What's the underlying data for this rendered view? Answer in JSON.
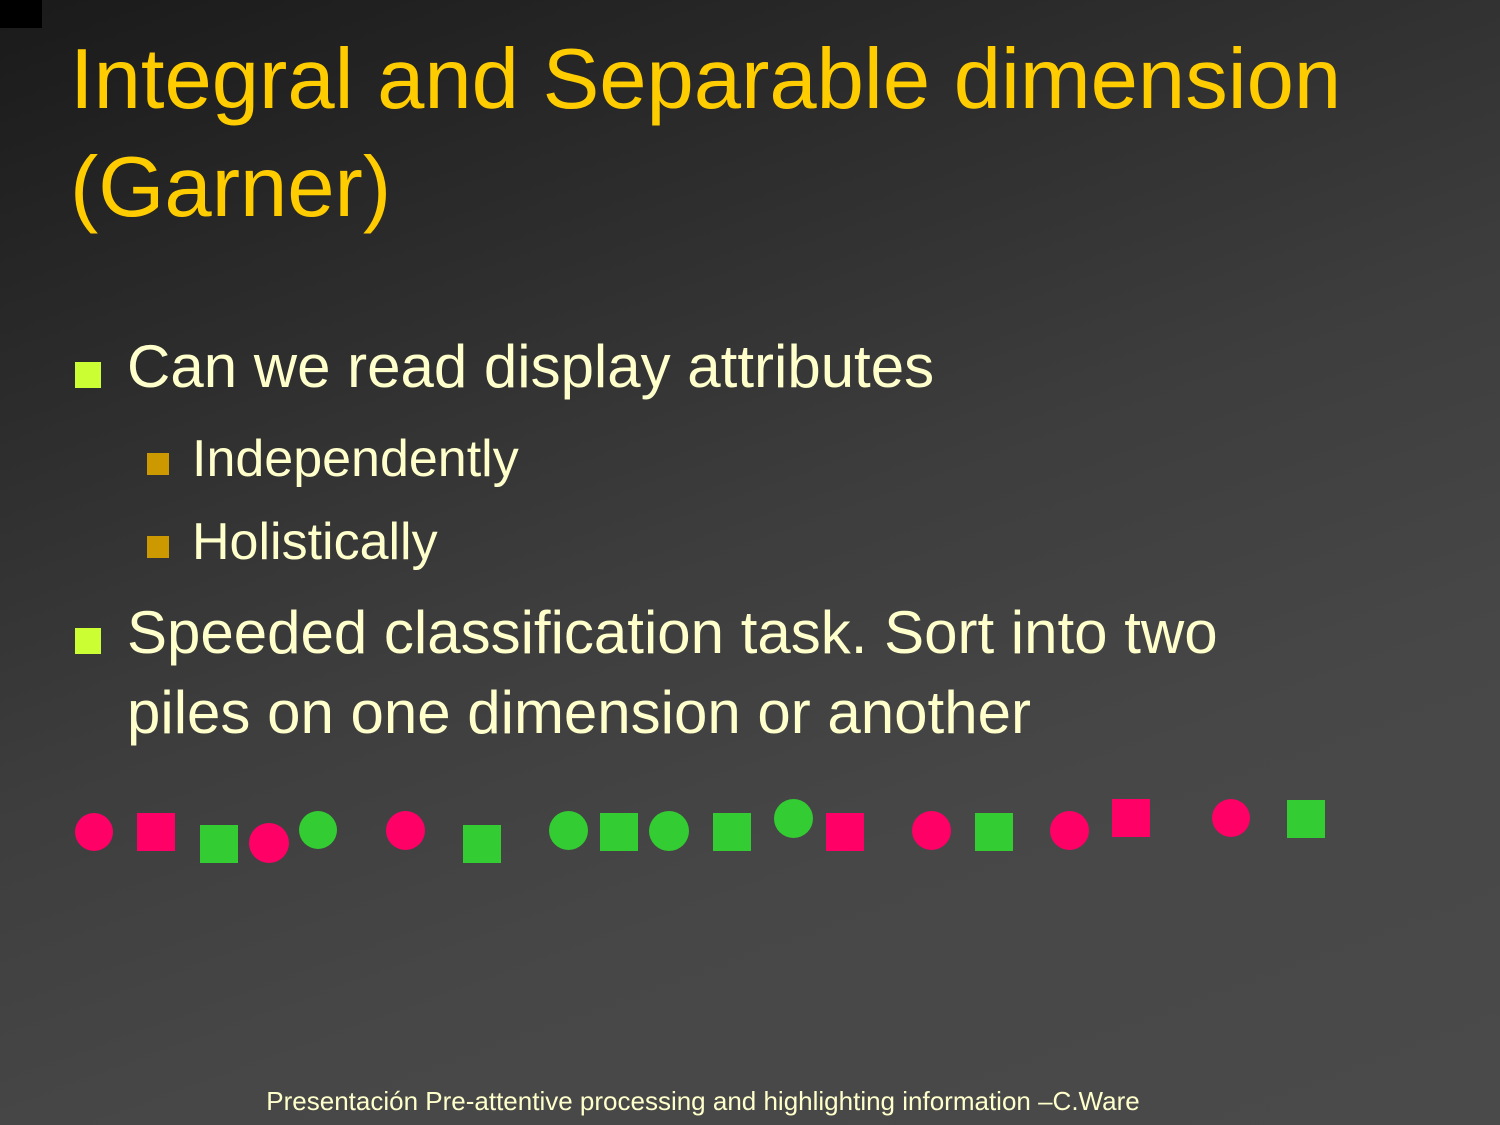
{
  "title": "Integral and Separable dimension (Garner)",
  "bullets": [
    {
      "text": "Can we read display attributes",
      "children": [
        "Independently",
        "Holistically"
      ]
    },
    {
      "text_line1": "Speeded classification task. Sort into two",
      "text_line2": "piles on one dimension or another"
    }
  ],
  "colors": {
    "title": "#ffcc00",
    "body_text": "#ffffcc",
    "level1_bullet": "#ccff33",
    "level2_bullet": "#cc9900",
    "pink": "#ff0066",
    "green": "#33cc33"
  },
  "shape_sequence": [
    {
      "shape": "circle",
      "color": "pink"
    },
    {
      "shape": "square",
      "color": "pink"
    },
    {
      "shape": "square",
      "color": "green"
    },
    {
      "shape": "circle",
      "color": "pink"
    },
    {
      "shape": "circle",
      "color": "green"
    },
    {
      "shape": "circle",
      "color": "pink"
    },
    {
      "shape": "square",
      "color": "green"
    },
    {
      "shape": "circle",
      "color": "green"
    },
    {
      "shape": "square",
      "color": "green"
    },
    {
      "shape": "circle",
      "color": "green"
    },
    {
      "shape": "square",
      "color": "green"
    },
    {
      "shape": "circle",
      "color": "green"
    },
    {
      "shape": "square",
      "color": "pink"
    },
    {
      "shape": "circle",
      "color": "pink"
    },
    {
      "shape": "square",
      "color": "green"
    },
    {
      "shape": "circle",
      "color": "pink"
    },
    {
      "shape": "square",
      "color": "pink"
    },
    {
      "shape": "circle",
      "color": "pink"
    },
    {
      "shape": "square",
      "color": "green"
    }
  ],
  "footer": "Presentación Pre-attentive processing and highlighting information –C.Ware"
}
